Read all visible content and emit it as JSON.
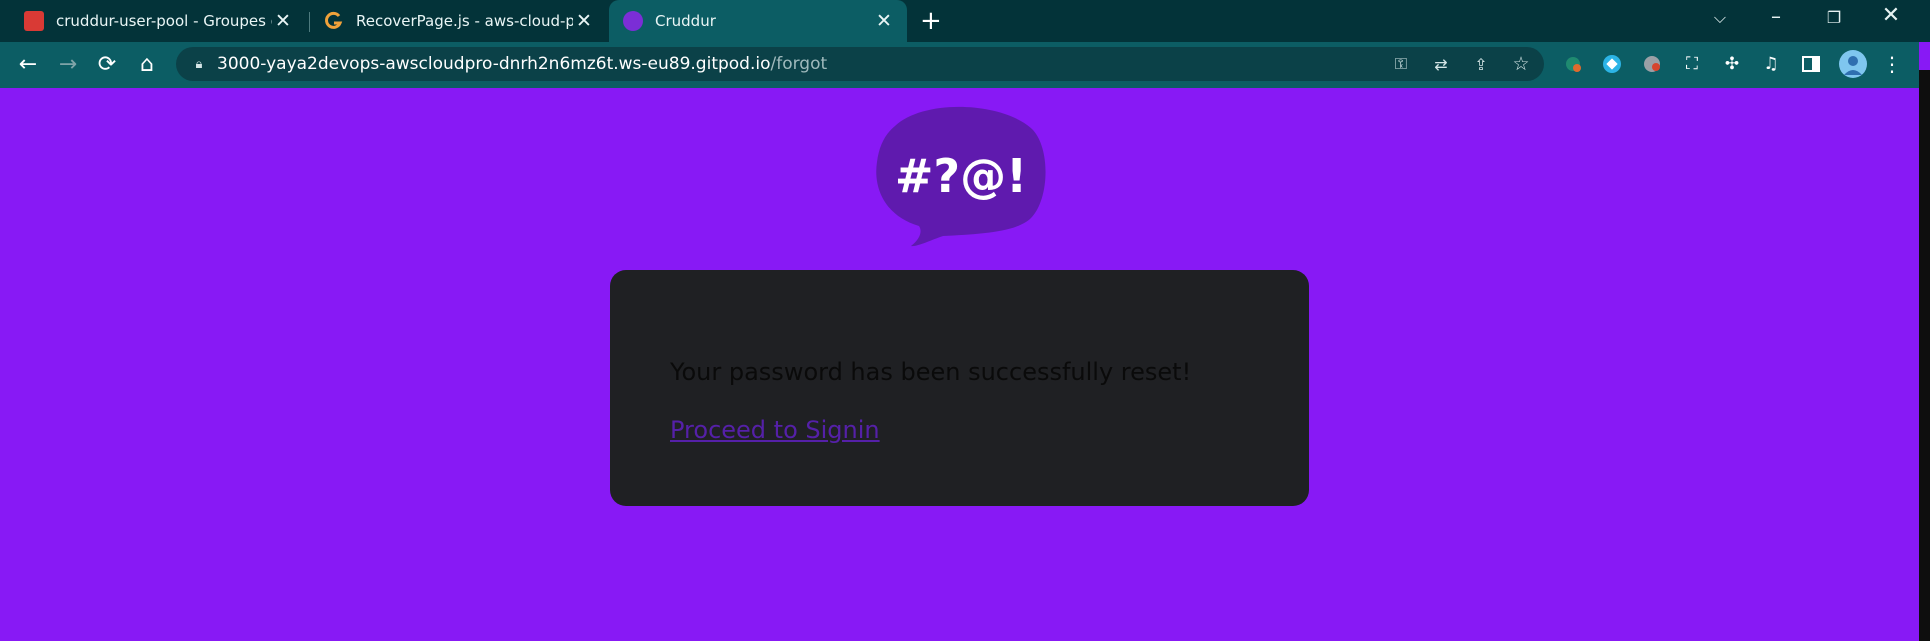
{
  "browser": {
    "tabs": [
      {
        "title": "cruddur-user-pool - Groupes d'u",
        "favicon": "aws-cognito-icon",
        "active": false
      },
      {
        "title": "RecoverPage.js - aws-cloud-proje",
        "favicon": "gitpod-icon",
        "active": false
      },
      {
        "title": "Cruddur",
        "favicon": "cruddur-icon",
        "active": true
      }
    ],
    "url_host": "3000-yaya2devops-awscloudpro-dnrh2n6mz6t.ws-eu89.gitpod.io",
    "url_path": "/forgot"
  },
  "page": {
    "logo_text": "#?@!",
    "message": "Your password has been successfully reset!",
    "link_text": "Proceed to Signin"
  },
  "colors": {
    "background": "#8819F5",
    "card": "#1F2023",
    "logo_bubble": "#5F1AAE",
    "link": "#5520A8"
  }
}
